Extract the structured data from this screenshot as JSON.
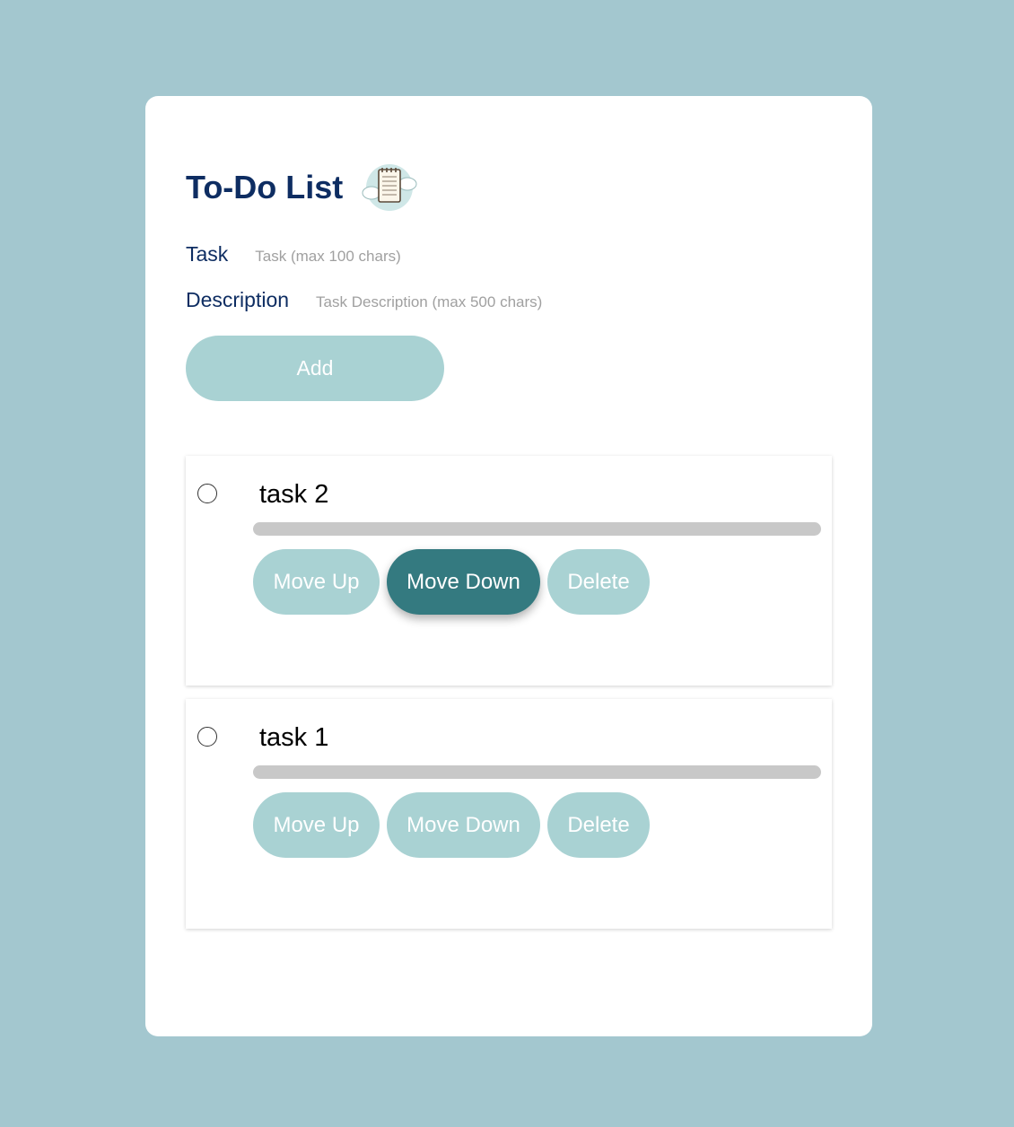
{
  "app": {
    "title": "To-Do List",
    "title_icon": "notepad-cloud-icon"
  },
  "form": {
    "task_label": "Task",
    "task_placeholder": "Task (max 100 chars)",
    "task_value": "",
    "description_label": "Description",
    "description_placeholder": "Task Description (max 500 chars)",
    "description_value": "",
    "add_label": "Add"
  },
  "tasks": [
    {
      "title": "task 2",
      "completed": false,
      "move_up_label": "Move Up",
      "move_down_label": "Move Down",
      "delete_label": "Delete",
      "hovered_button": "move_down"
    },
    {
      "title": "task 1",
      "completed": false,
      "move_up_label": "Move Up",
      "move_down_label": "Move Down",
      "delete_label": "Delete",
      "hovered_button": null
    }
  ],
  "colors": {
    "page_background": "#a3c7cf",
    "heading": "#0e2d62",
    "button": "#a9d2d3",
    "button_active": "#347a80",
    "description_bar": "#c8c8c8"
  }
}
